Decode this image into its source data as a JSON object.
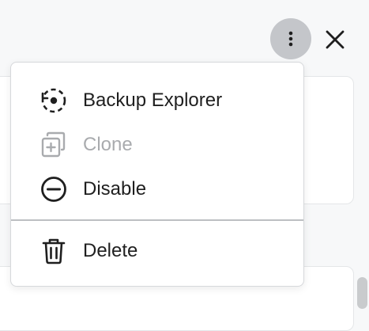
{
  "header": {
    "more_icon": "more-vertical-icon",
    "close_icon": "close-icon"
  },
  "menu": {
    "items": [
      {
        "label": "Backup Explorer",
        "icon": "backup-explorer-icon",
        "disabled": false
      },
      {
        "label": "Clone",
        "icon": "clone-icon",
        "disabled": true
      },
      {
        "label": "Disable",
        "icon": "disable-icon",
        "disabled": false
      },
      {
        "label": "Delete",
        "icon": "trash-icon",
        "disabled": false
      }
    ]
  },
  "colors": {
    "text": "#1f1f1f",
    "disabled_text": "#a9abae",
    "more_button_bg": "#c4c6ca",
    "page_bg": "#f7f8f9"
  }
}
